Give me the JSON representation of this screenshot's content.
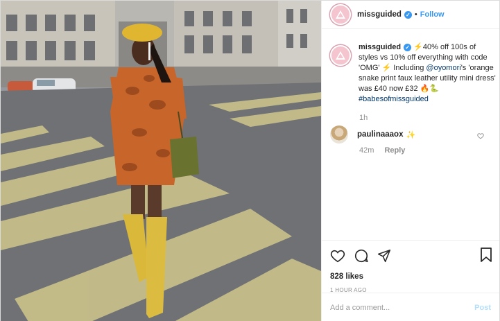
{
  "account": {
    "username": "missguided",
    "verified_mark": "✓"
  },
  "header": {
    "separator": "•",
    "follow_label": "Follow"
  },
  "caption": {
    "username": "missguided",
    "emoji_bolt": "⚡",
    "text_1": "40% off 100s of styles vs 10% off everything with code 'OMG' ",
    "text_2": " Including ",
    "mention": "@oyomori",
    "text_3": "'s 'orange snake print faux leather utility mini dress' was £40 now £32 ",
    "emoji_end": "🔥🐍",
    "hashtag": "#babesofmissguided",
    "time": "1h"
  },
  "comment": {
    "username": "paulinaaaox",
    "emoji": "✨",
    "time": "42m",
    "reply_label": "Reply"
  },
  "stats": {
    "likes": "828 likes",
    "posted_ago": "1 hour ago"
  },
  "composer": {
    "placeholder": "Add a comment...",
    "post_label": "Post"
  },
  "icons": [
    "heart-icon",
    "comment-icon",
    "share-icon",
    "bookmark-icon",
    "like-comment-icon"
  ],
  "colors": {
    "accent": "#3897f0",
    "brand_avatar": "#f4c4cf",
    "post_disabled": "#b2dffc"
  }
}
